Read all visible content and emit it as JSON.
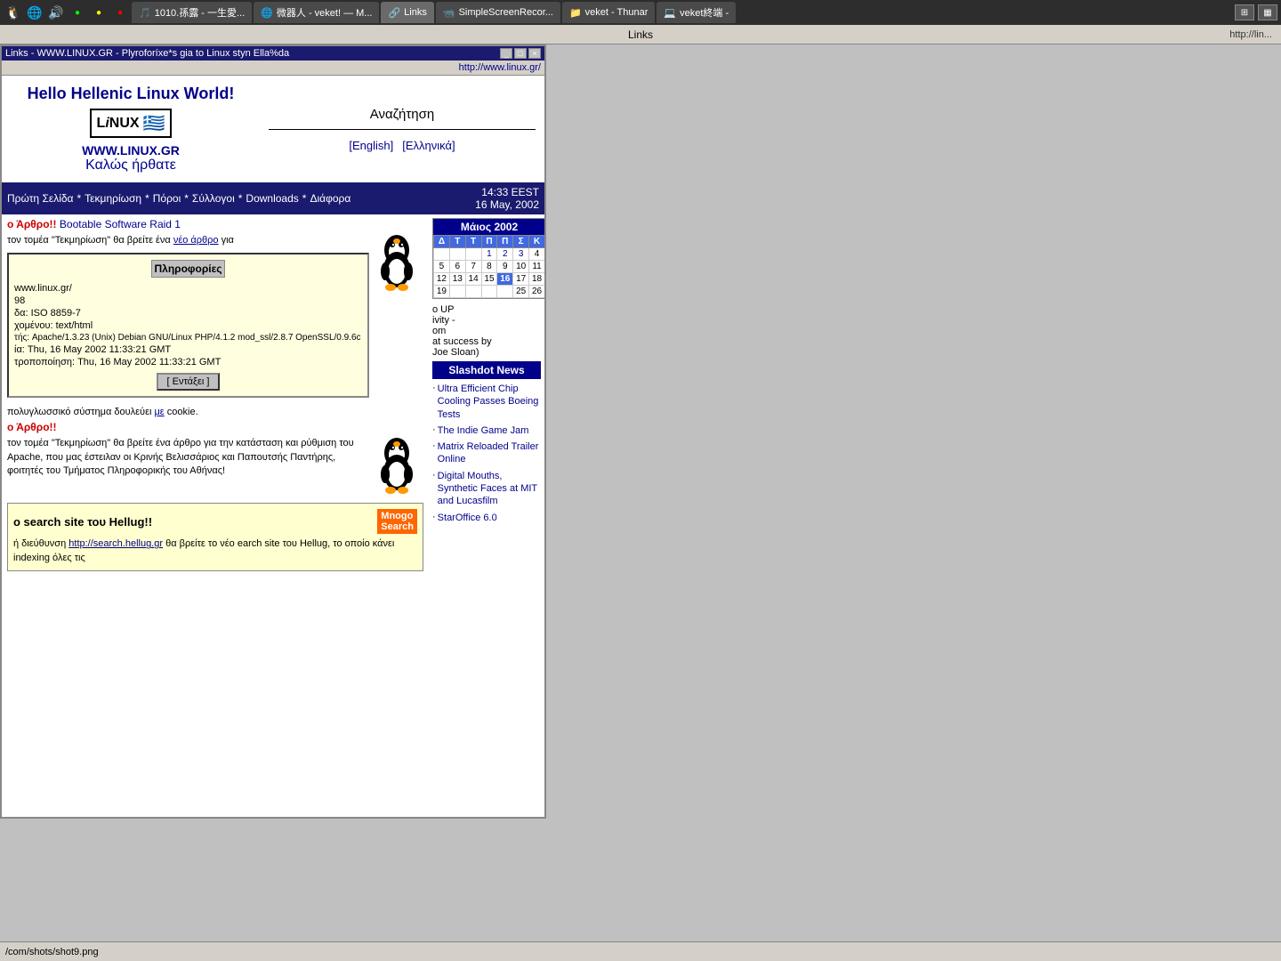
{
  "taskbar": {
    "icons": [
      {
        "name": "app-icon-1",
        "symbol": "🐧"
      },
      {
        "name": "app-icon-2",
        "symbol": "🌐"
      },
      {
        "name": "app-icon-3",
        "symbol": "🔊"
      },
      {
        "name": "app-icon-4",
        "symbol": "●"
      },
      {
        "name": "app-icon-5",
        "symbol": "●"
      },
      {
        "name": "app-icon-6",
        "symbol": "●"
      }
    ],
    "tabs": [
      {
        "label": "1010.孫露 - 一生愛...",
        "active": false,
        "favicon": "🎵"
      },
      {
        "label": "微器人 - veket! — M...",
        "active": false,
        "favicon": "🌐"
      },
      {
        "label": "Links",
        "active": true,
        "favicon": "🔗"
      },
      {
        "label": "SimpleScreenRecor...",
        "active": false,
        "favicon": "📹"
      },
      {
        "label": "veket - Thunar",
        "active": false,
        "favicon": "📁"
      },
      {
        "label": "veket終端 -",
        "active": false,
        "favicon": "💻"
      }
    ],
    "right_icons": [
      {
        "name": "sys-icon-1",
        "symbol": "⊞"
      },
      {
        "name": "sys-icon-2",
        "symbol": "▦"
      }
    ]
  },
  "window_title": "Links",
  "url_bar": "http://lin...",
  "browser": {
    "title": "Links - WWW.LINUX.GR - Plyroforíxe*s gia to Linux styn Ella%da",
    "url": "http://www.linux.gr/",
    "win_buttons": [
      "_",
      "□",
      "×"
    ]
  },
  "site": {
    "logo_text": "LiNUX",
    "hello": "Hello Hellenic Linux World!",
    "domain": "WWW.LINUX.GR",
    "welcome": "Καλώς ήρθατε",
    "search_title": "Αναζήτηση",
    "lang_english": "[English]",
    "lang_greek": "[Ελληνικά]",
    "nav_items": [
      "Πρώτη Σελίδα",
      "*",
      "Τεκμηρίωση",
      "*",
      "Πόροι",
      "*",
      "Σύλλογοι",
      "*",
      "Downloads",
      "*",
      "Διάφορα"
    ],
    "datetime_line1": "14:33 EEST",
    "datetime_line2": "16 May, 2002",
    "article1_title": "ο Άρθρο!! Bootable Software Raid 1",
    "article1_body": "τον τομέα \"Τεκμηρίωση\" θα βρείτε ένα",
    "article1_link": "νέο άρθρο",
    "article1_rest": "για",
    "info_popup_title": "Πληροφορίες",
    "info_rows": [
      "www.linux.gr/",
      "98",
      "δα: ISO 8859-7",
      "χομένου: text/html",
      "τής: Apache/1.3.23 (Unix) Debian GNU/Linux PHP/4.1.2 mod_ssl/2.8.7 OpenSSL/0.9.6c",
      "ία: Thu, 16 May 2002 11:33:21 GMT",
      "τροποποίηση: Thu, 16 May 2002 11:33:21 GMT"
    ],
    "info_btn": "[ Εντάξει ]",
    "cookie_notice": "πολυγλωσσικό σύστημα δουλεύει με cookie.",
    "cookie_link": "me",
    "article2_title": "ο Άρθρο!!",
    "article2_body": "τον τομέα \"Τεκμηρίωση\" θα βρείτε ένα άρθρο για την κατάσταση και ρύθμιση του Apache, που μας έστειλαν οι Κρινής Βελισσάριος και Παπουτσής Παντήρης, φοιτητές του Τμήματος Πληροφορικής του Αθήνας!",
    "search_site_title": "o search site του Hellug!!",
    "search_site_body1": "ή διεύθυνση",
    "search_site_link": "http://search.hellug.gr",
    "search_site_body2": "θα βρείτε το νέο earch site του Hellug, το οποίο κάνει indexing όλες τις",
    "calendar": {
      "header": "Μάιος 2002",
      "weekdays": [
        "Δ",
        "Τ",
        "Τ",
        "Π",
        "Π",
        "Σ",
        "Κ"
      ],
      "weeks": [
        [
          "",
          "",
          "",
          "1",
          "2",
          "3",
          "4",
          "5"
        ],
        [
          "6",
          "7",
          "8",
          "9",
          "10",
          "11",
          "12"
        ],
        [
          "13",
          "14",
          "15",
          "16",
          "17",
          "18",
          "19"
        ],
        [
          "",
          "",
          "",
          "",
          "",
          "25",
          "26"
        ]
      ],
      "today": "16"
    },
    "slashdot_header": "Slashdot News",
    "slashdot_items": [
      "Ultra Efficient Chip Cooling Passes Boeing Tests",
      "The Indie Game Jam",
      "Matrix Reloaded Trailer Online",
      "Digital Mouths, Synthetic Faces at MIT and Lucasfilm",
      "StarOffice 6.0"
    ],
    "sidebar_extra1": "o UP",
    "sidebar_extra2": "ivity -",
    "sidebar_extra3": "om",
    "sidebar_extra4": "at success by",
    "sidebar_extra5": "Joe Sloan)"
  },
  "status_bar": {
    "text": "/com/shots/shot9.png"
  }
}
